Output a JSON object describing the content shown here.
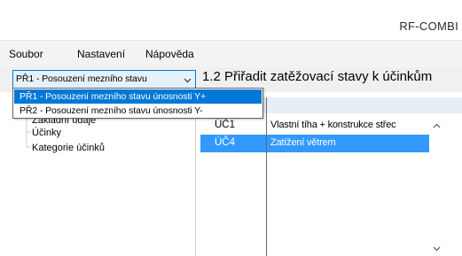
{
  "window": {
    "title": "RF-COMBI"
  },
  "menu": [
    "Soubor",
    "Nastavení",
    "Nápověda"
  ],
  "toolbar": {
    "combo_value": "PŘ1 - Posouzení mezního stavu",
    "heading": "1.2 Přiřadit zatěžovací stavy k účinkům"
  },
  "dropdown": {
    "options": [
      "PŘ1 - Posouzení mezního stavu únosnosti Y+",
      "PŘ2 - Posouzení mezního stavu únosnosti Y-"
    ],
    "selected_index": 0
  },
  "tree": {
    "items": [
      "Základní údaje",
      "Účinky",
      "Kategorie účinků"
    ]
  },
  "table": {
    "rows": [
      {
        "code": "ÚČ1",
        "name": "Vlastní tíha + konstrukce střec",
        "selected": false
      },
      {
        "code": "ÚČ4",
        "name": "Zatížení větrem",
        "selected": true
      }
    ]
  },
  "colors": {
    "selection": "#3399ff",
    "dropdown_selection": "#0078d7",
    "combo_background": "#e5f1fb"
  },
  "icons": [
    "chevron-down-icon",
    "scroll-up-arrow-icon",
    "scroll-down-arrow-icon"
  ]
}
